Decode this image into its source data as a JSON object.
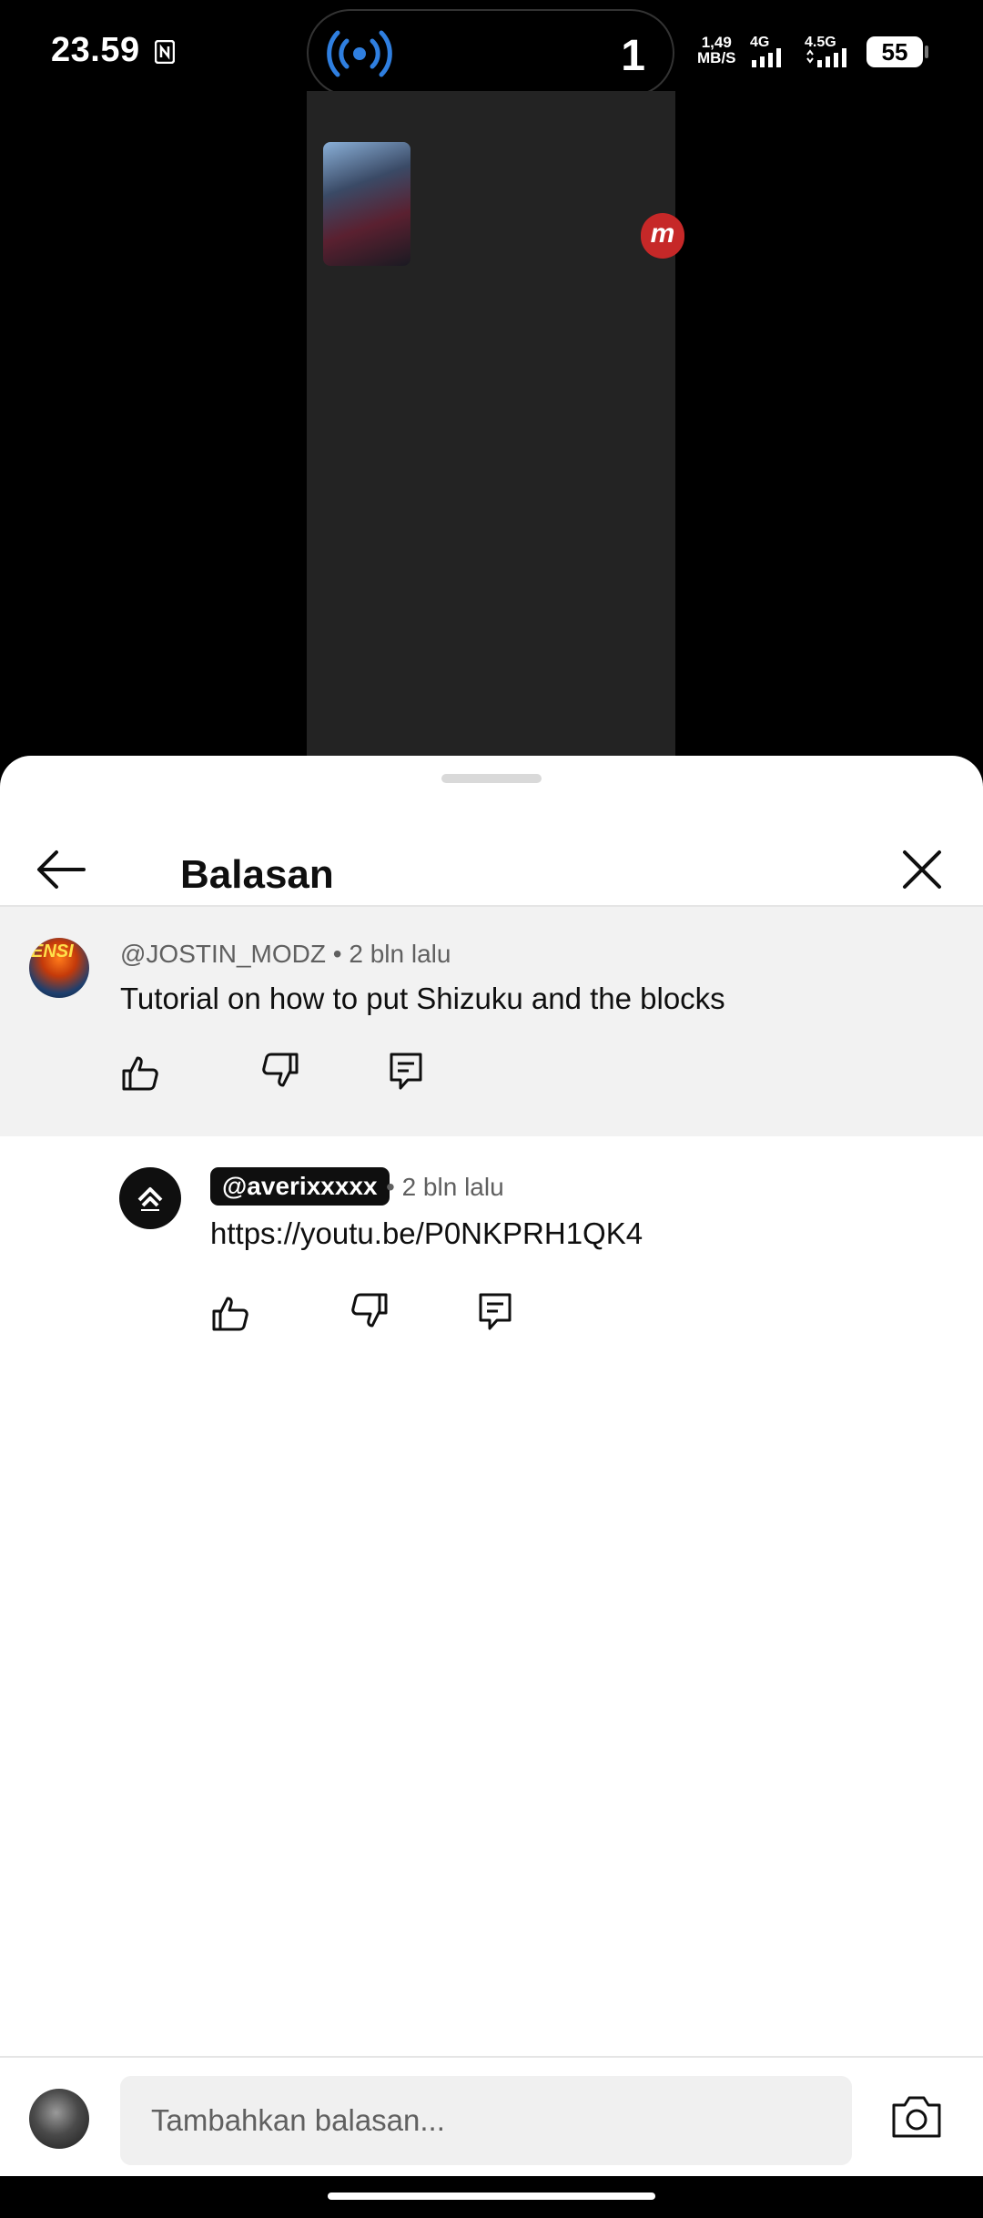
{
  "status_bar": {
    "time": "23.59",
    "island_count": "1",
    "speed_value": "1,49",
    "speed_unit": "MB/S",
    "net1": "4G",
    "net2": "4.5G",
    "battery": "55"
  },
  "video": {
    "logo_letter": "m"
  },
  "sheet": {
    "title": "Balasan"
  },
  "parent_comment": {
    "author": "@JOSTIN_MODZ",
    "time": "• 2 bln lalu",
    "text": "Tutorial on how to put Shizuku and the blocks"
  },
  "reply": {
    "author": "@averixxxxx",
    "time": "• 2 bln lalu",
    "text": "https://youtu.be/P0NKPRH1QK4"
  },
  "compose": {
    "placeholder": "Tambahkan balasan..."
  },
  "colors": {
    "cast_blue": "#2f7fe0",
    "sheet_bg": "#ffffff",
    "highlight_bg": "#f2f2f2"
  }
}
